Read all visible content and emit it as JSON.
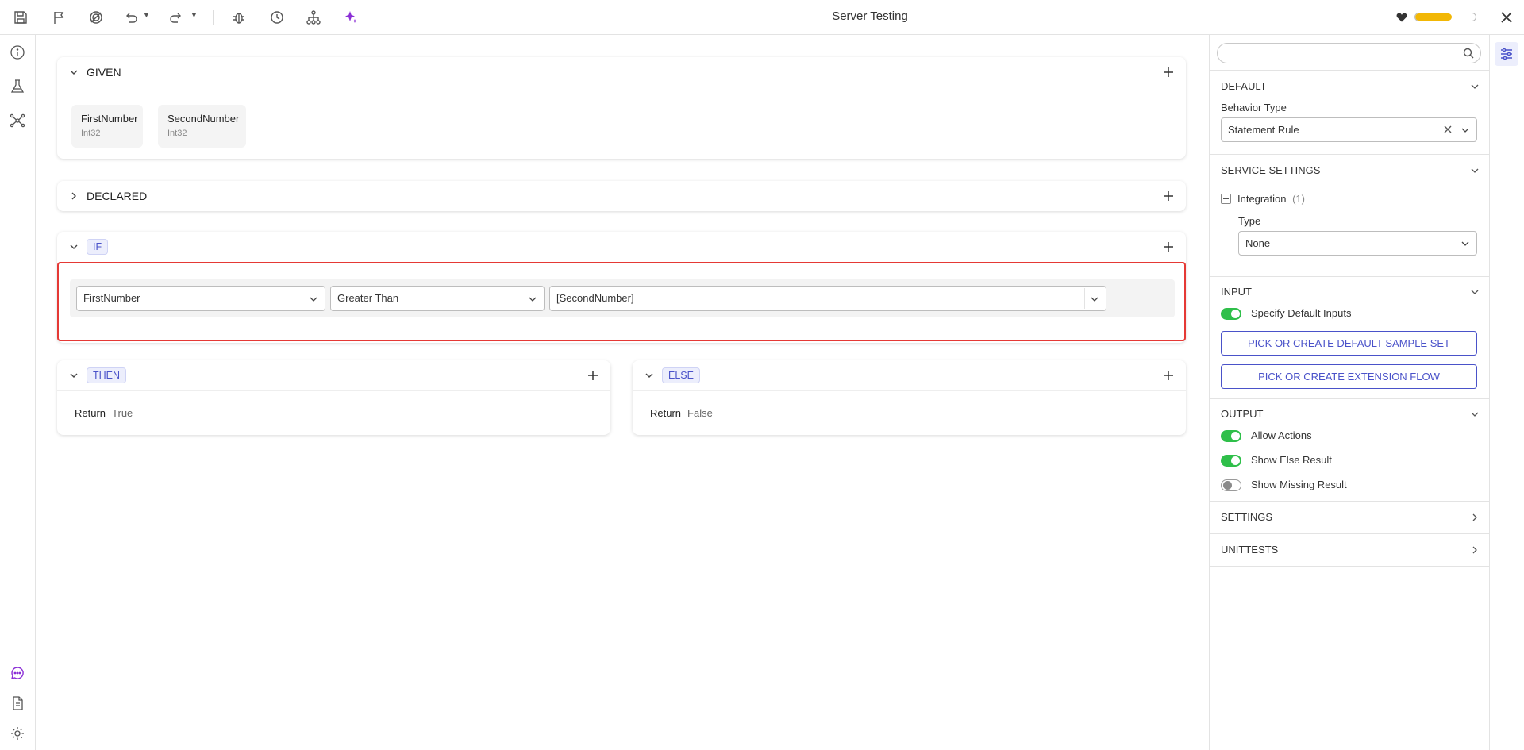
{
  "app": {
    "title": "Server Testing",
    "health_level": 0.6,
    "accent_color": "#4a52c9",
    "health_color": "#f2b705",
    "highlight_color": "#e53935"
  },
  "toolbar": {
    "icons": [
      "save-icon",
      "flag-icon",
      "target-icon",
      "undo-icon",
      "redo-icon",
      "debug-icon",
      "history-icon",
      "hierarchy-icon",
      "ai-sparkle-icon"
    ]
  },
  "left_rail": {
    "icons": [
      "info-icon",
      "flask-icon",
      "network-icon",
      "chat-icon",
      "document-icon",
      "settings-gear-icon"
    ]
  },
  "given": {
    "title": "GIVEN",
    "params": [
      {
        "name": "FirstNumber",
        "type": "Int32"
      },
      {
        "name": "SecondNumber",
        "type": "Int32"
      }
    ]
  },
  "declared": {
    "title": "DECLARED"
  },
  "if_section": {
    "tag": "IF",
    "condition": {
      "left": "FirstNumber",
      "operator": "Greater Than",
      "right": "[SecondNumber]"
    }
  },
  "then_section": {
    "tag": "THEN",
    "keyword": "Return",
    "value": "True"
  },
  "else_section": {
    "tag": "ELSE",
    "keyword": "Return",
    "value": "False"
  },
  "panel": {
    "search": {
      "placeholder": ""
    },
    "default": {
      "title": "DEFAULT",
      "behavior_label": "Behavior Type",
      "behavior_value": "Statement Rule"
    },
    "service": {
      "title": "SERVICE SETTINGS",
      "integration_label": "Integration",
      "integration_count": "(1)",
      "type_label": "Type",
      "type_value": "None"
    },
    "input": {
      "title": "INPUT",
      "specify_label": "Specify Default Inputs",
      "specify_on": true,
      "sample_button": "PICK OR CREATE DEFAULT SAMPLE SET",
      "extension_button": "PICK OR CREATE EXTENSION FLOW"
    },
    "output": {
      "title": "OUTPUT",
      "toggles": [
        {
          "label": "Allow Actions",
          "on": true
        },
        {
          "label": "Show Else Result",
          "on": true
        },
        {
          "label": "Show Missing Result",
          "on": false
        }
      ]
    },
    "settings": {
      "title": "SETTINGS"
    },
    "unittests": {
      "title": "UNITTESTS"
    }
  }
}
